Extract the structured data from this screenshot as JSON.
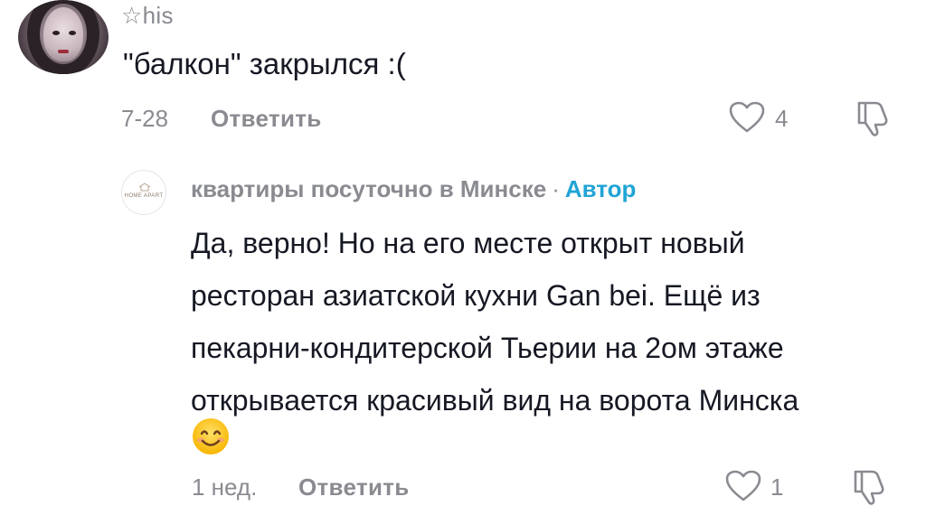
{
  "comments": [
    {
      "username": "☆his",
      "text": "\"балкон\" закрылся :(",
      "date": "7-28",
      "reply_label": "Ответить",
      "likes": "4"
    },
    {
      "username": "квартиры посуточно в Минске",
      "separator": "·",
      "author_badge": "Автор",
      "avatar_brand": "HOME APART",
      "text_lines": [
        "Да, верно! Но на его месте открыт новый",
        "ресторан азиатской кухни Gan bei. Ещё из",
        "пекарни-кондитерской Тьерии на 2ом этаже",
        "открывается красивый вид на ворота Минска"
      ],
      "emoji": "smiling-face-emoji",
      "date": "1 нед.",
      "reply_label": "Ответить",
      "likes": "1"
    }
  ],
  "colors": {
    "text": "#161823",
    "muted": "#8a8b91",
    "author": "#20a4d6"
  }
}
